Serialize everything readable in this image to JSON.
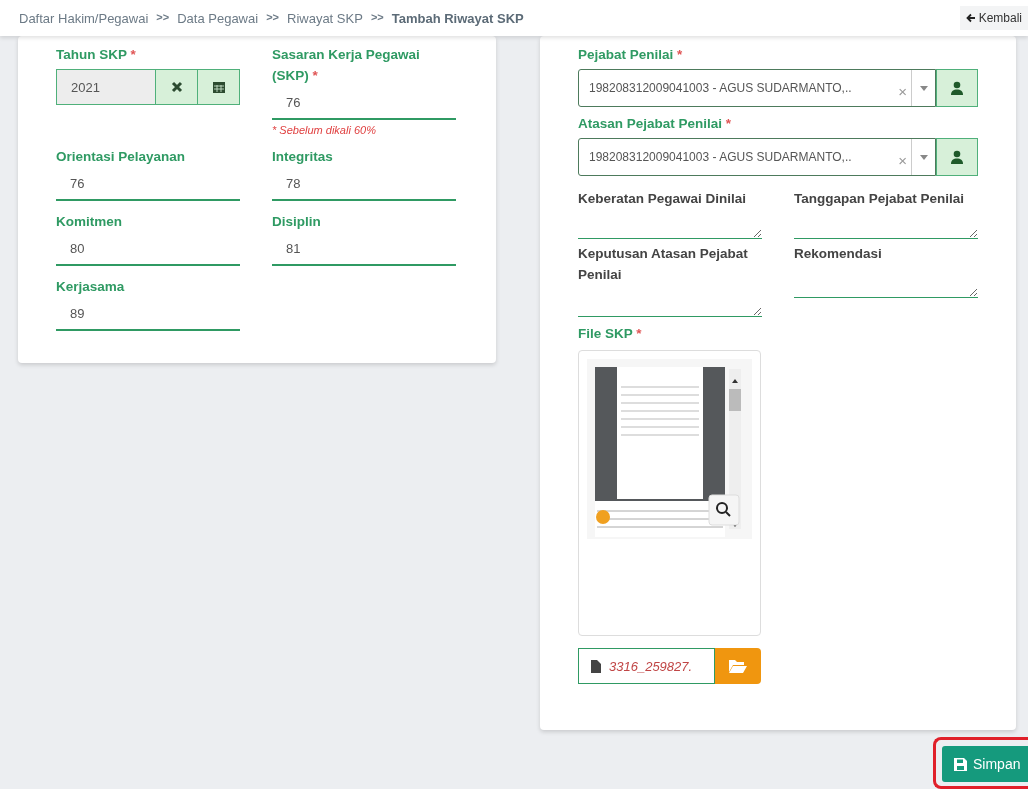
{
  "breadcrumb": [
    {
      "label": "Daftar Hakim/Pegawai",
      "current": false
    },
    {
      "label": "Data Pegawai",
      "current": false
    },
    {
      "label": "Riwayat SKP",
      "current": false
    },
    {
      "label": "Tambah Riwayat SKP",
      "current": true
    }
  ],
  "separator": ">>",
  "back_button": {
    "label": "Kembali"
  },
  "left_form": {
    "fields": [
      {
        "kind": "year",
        "label": "Tahun SKP",
        "required_mark": "*",
        "value": "2021"
      },
      {
        "kind": "text",
        "label": "Sasaran Kerja Pegawai (SKP)",
        "required_mark": "*",
        "value": "76",
        "note": "* Sebelum dikali 60%"
      },
      {
        "kind": "text",
        "label": "Orientasi Pelayanan",
        "value": "76"
      },
      {
        "kind": "text",
        "label": "Integritas",
        "value": "78"
      },
      {
        "kind": "text",
        "label": "Komitmen",
        "value": "80"
      },
      {
        "kind": "text",
        "label": "Disiplin",
        "value": "81"
      },
      {
        "kind": "text",
        "label": "Kerjasama",
        "value": "89"
      }
    ]
  },
  "right_form": {
    "selects": [
      {
        "label": "Pejabat Penilai",
        "required_mark": "*",
        "value": "198208312009041003 - AGUS SUDARMANTO,..",
        "clear": "×"
      },
      {
        "label": "Atasan Pejabat Penilai",
        "required_mark": "*",
        "value": "198208312009041003 - AGUS SUDARMANTO,..",
        "clear": "×"
      }
    ],
    "textareas": [
      {
        "label": "Keberatan Pegawai Dinilai"
      },
      {
        "label": "Tanggapan Pejabat Penilai"
      },
      {
        "label": "Keputusan Atasan Pejabat Penilai"
      },
      {
        "label": "Rekomendasi"
      }
    ],
    "file": {
      "label": "File SKP",
      "required_mark": "*",
      "filename": "3316_259827."
    }
  },
  "save_button": {
    "label": "Simpan",
    "highlighted": true
  }
}
